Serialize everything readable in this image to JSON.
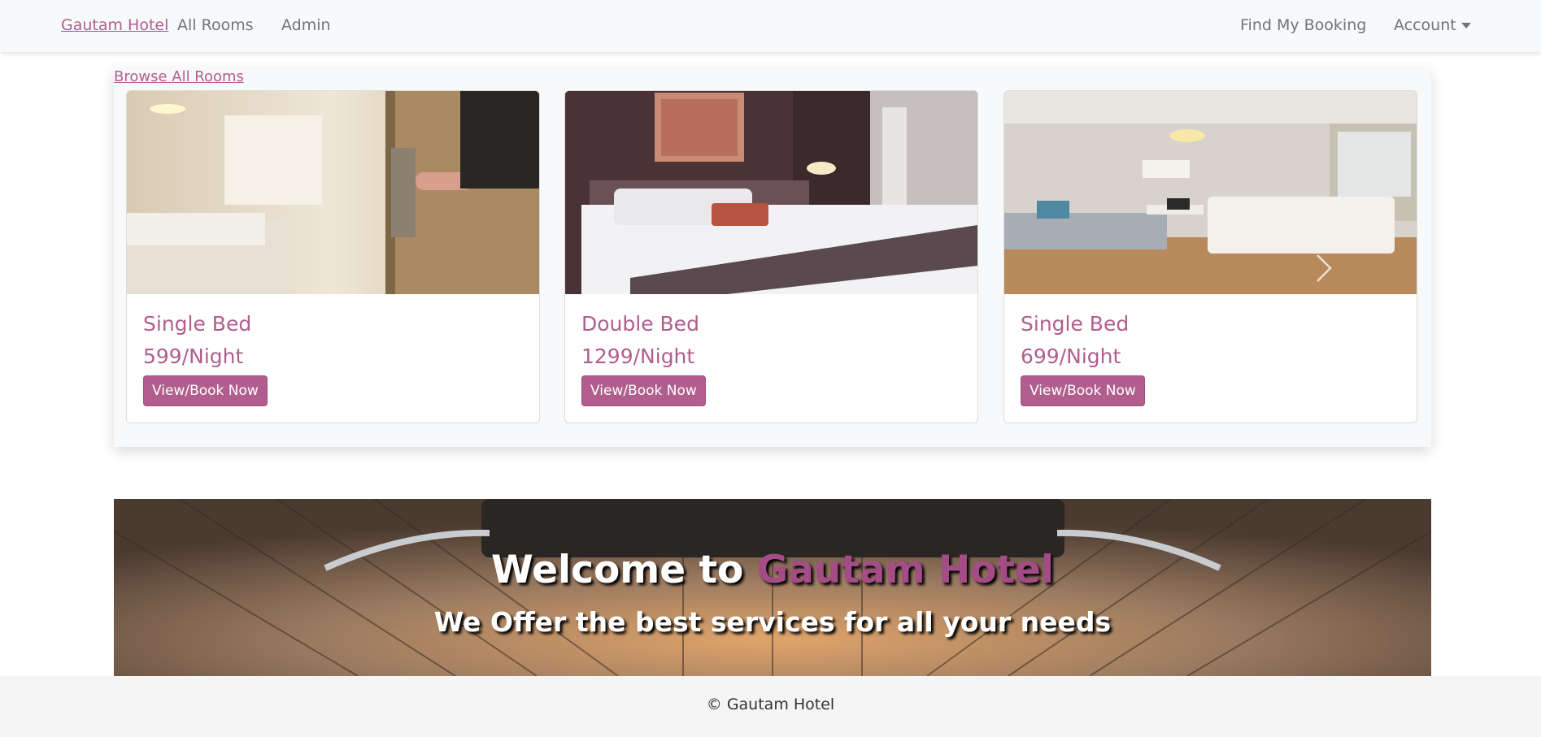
{
  "navbar": {
    "brand": "Gautam Hotel",
    "links": [
      "All Rooms",
      "Admin"
    ],
    "right_links": [
      "Find My Booking",
      "Account"
    ]
  },
  "carousel": {
    "browse_link": "Browse All Rooms",
    "cards": [
      {
        "title": "Single Bed",
        "price": "599/Night",
        "button": "View/Book Now"
      },
      {
        "title": "Double Bed",
        "price": "1299/Night",
        "button": "View/Book Now"
      },
      {
        "title": "Single Bed",
        "price": "699/Night",
        "button": "View/Book Now"
      }
    ]
  },
  "hero": {
    "title_prefix": "Welcome to",
    "title_accent": "Gautam Hotel",
    "subtitle": "We Offer the best services for all your needs"
  },
  "footer": {
    "text": "© Gautam Hotel"
  },
  "colors": {
    "accent": "#b15e8e",
    "navbar_bg": "#f8f9fa",
    "footer_bg": "#f5f5f5"
  },
  "icons": {
    "prev": "chevron-left-icon",
    "next": "chevron-right-icon",
    "account_caret": "caret-down-icon"
  }
}
